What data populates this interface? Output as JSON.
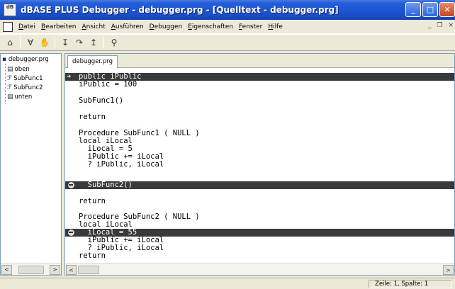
{
  "window": {
    "title": "dBASE PLUS Debugger - debugger.prg - [Quelltext - debugger.prg]",
    "app_icon_text": "dB"
  },
  "menu": {
    "items": [
      "Datei",
      "Bearbeiten",
      "Ansicht",
      "Ausführen",
      "Debuggen",
      "Eigenschaften",
      "Fenster",
      "Hilfe"
    ]
  },
  "toolbar": {
    "icons": [
      "open-icon",
      "filter-icon",
      "hand-icon",
      "step-into-icon",
      "step-over-icon",
      "step-out-icon",
      "watch-icon"
    ]
  },
  "tree": {
    "root": "debugger.prg",
    "items": [
      "oben",
      "SubFunc1",
      "SubFunc2",
      "unten"
    ]
  },
  "editor": {
    "tab": "debugger.prg",
    "lines": [
      "public iPublic",
      "iPublic = 100",
      "",
      "SubFunc1()",
      "",
      "return",
      "",
      "Procedure SubFunc1 ( NULL )",
      "local iLocal",
      "  iLocal = 5",
      "  iPublic += iLocal",
      "  ? iPublic, iLocal",
      "",
      "  SubFunc2()",
      "",
      "return",
      "",
      "Procedure SubFunc2 ( NULL )",
      "local iLocal",
      "  iLocal = 55",
      "  iPublic += iLocal",
      "  ? iPublic, iLocal",
      "return"
    ]
  },
  "status": {
    "position": "Zeile: 1, Spalte: 1"
  }
}
